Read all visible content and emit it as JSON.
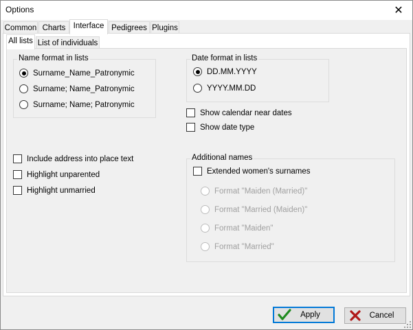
{
  "window": {
    "title": "Options"
  },
  "tabs": {
    "main": [
      "Common",
      "Charts",
      "Interface",
      "Pedigrees",
      "Plugins"
    ],
    "sub": [
      "All lists",
      "List of individuals"
    ]
  },
  "name_format": {
    "legend": "Name format in lists",
    "options": [
      "Surname_Name_Patronymic",
      "Surname; Name_Patronymic",
      "Surname; Name; Patronymic"
    ],
    "selected": "Surname_Name_Patronymic"
  },
  "date_format": {
    "legend": "Date format in lists",
    "options": [
      "DD.MM.YYYY",
      "YYYY.MM.DD"
    ],
    "selected": "DD.MM.YYYY"
  },
  "checks": {
    "show_calendar": "Show calendar near dates",
    "show_date_type": "Show date type",
    "include_address": "Include address into place text",
    "highlight_unparented": "Highlight unparented",
    "highlight_unmarried": "Highlight unmarried"
  },
  "additional_names": {
    "legend": "Additional names",
    "extended": "Extended women's surnames",
    "formats": [
      "Format \"Maiden (Married)\"",
      "Format \"Married (Maiden)\"",
      "Format \"Maiden\"",
      "Format \"Married\""
    ]
  },
  "buttons": {
    "apply": "Apply",
    "cancel": "Cancel"
  },
  "colors": {
    "accent": "#0078d7",
    "apply_icon": "#1f8a1f",
    "cancel_icon": "#b01818"
  }
}
